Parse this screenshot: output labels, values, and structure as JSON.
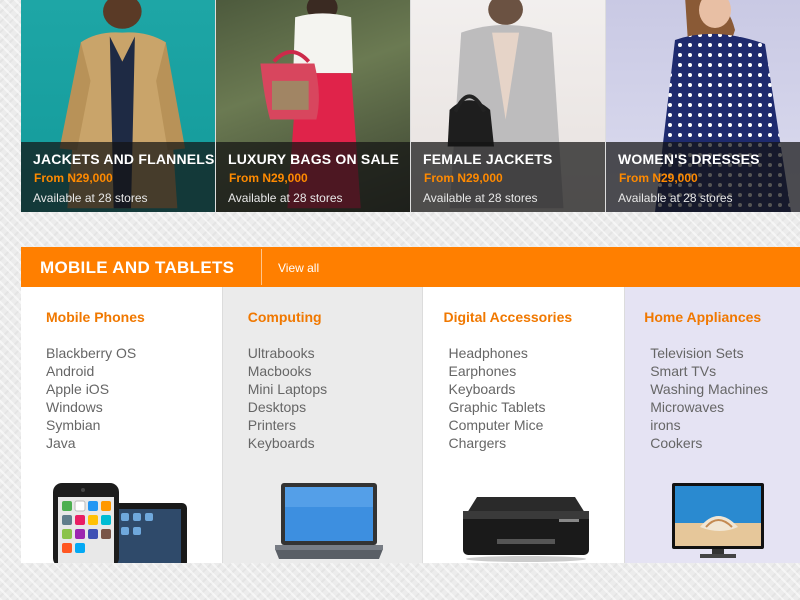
{
  "promos": [
    {
      "title": "JACKETS AND FLANNELS",
      "price": "From N29,000",
      "stores": "Available at 28 stores"
    },
    {
      "title": "LUXURY BAGS ON SALE",
      "price": "From N29,000",
      "stores": "Available at 28 stores"
    },
    {
      "title": "FEMALE JACKETS",
      "price": "From N29,000",
      "stores": "Available at 28 stores"
    },
    {
      "title": "WOMEN'S DRESSES",
      "price": "From N29,000",
      "stores": "Available at 28 stores"
    }
  ],
  "section": {
    "title": "MOBILE AND TABLETS",
    "view_all": "View all",
    "accent_color": "#ff7f00"
  },
  "categories": [
    {
      "title": "Mobile Phones",
      "items": [
        "Blackberry OS",
        "Android",
        "Apple iOS",
        "Windows",
        "Symbian",
        "Java"
      ],
      "image": "phone-tablet-image"
    },
    {
      "title": "Computing",
      "items": [
        "Ultrabooks",
        "Macbooks",
        "Mini Laptops",
        "Desktops",
        "Printers",
        "Keyboards"
      ],
      "image": "laptop-image"
    },
    {
      "title": "Digital Accessories",
      "items": [
        "Headphones",
        "Earphones",
        "Keyboards",
        "Graphic Tablets",
        "Computer Mice",
        "Chargers"
      ],
      "image": "printer-image"
    },
    {
      "title": "Home Appliances",
      "items": [
        "Television Sets",
        "Smart TVs",
        "Washing Machines",
        "Microwaves",
        "irons",
        "Cookers"
      ],
      "image": "tv-image"
    }
  ]
}
